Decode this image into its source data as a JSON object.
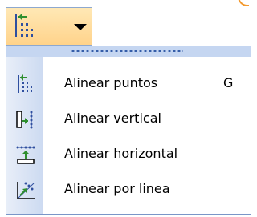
{
  "toolbar": {
    "split_button": {
      "icon": "align-points-icon",
      "dropdown_icon": "dropdown-arrow-icon"
    }
  },
  "menu": {
    "items": [
      {
        "label": "Alinear puntos",
        "shortcut": "G",
        "icon": "align-points-icon"
      },
      {
        "label": "Alinear vertical",
        "icon": "align-vertical-icon"
      },
      {
        "label": "Alinear horizontal",
        "icon": "align-horizontal-icon"
      },
      {
        "label": "Alinear por linea",
        "icon": "align-line-icon"
      }
    ]
  },
  "colors": {
    "menu_border": "#7a96c8",
    "grip_band": "#c5d6f1",
    "button_highlight": "#ffd38b",
    "icon_green": "#2f8f2f",
    "icon_blue": "#2f4f9f"
  }
}
